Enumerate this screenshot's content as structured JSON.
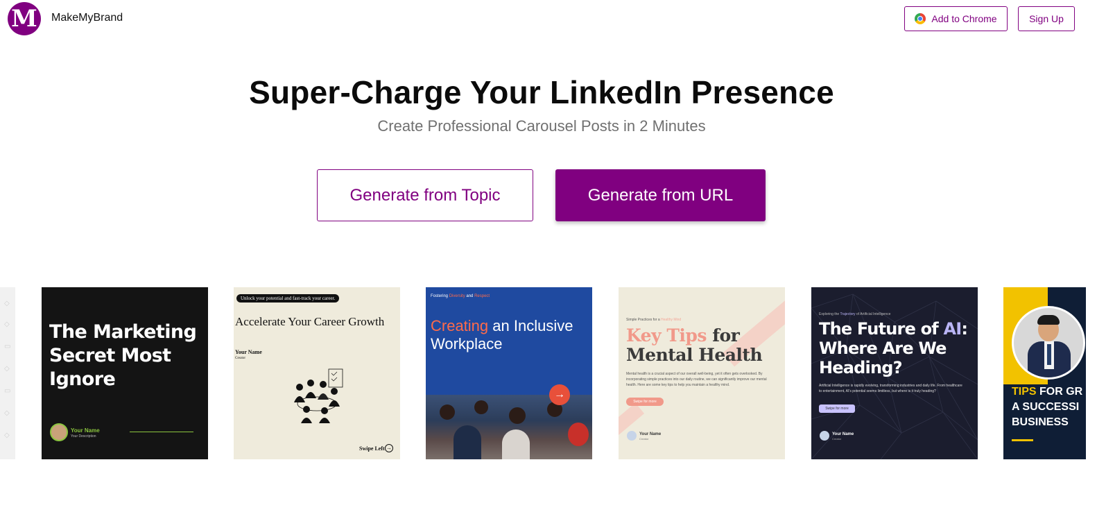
{
  "header": {
    "logo_letter": "M",
    "brand_name": "MakeMyBrand",
    "add_to_chrome_label": "Add to Chrome",
    "sign_up_label": "Sign Up"
  },
  "hero": {
    "title": "Super-Charge Your LinkedIn Presence",
    "subtitle": "Create Professional Carousel Posts in 2 Minutes",
    "generate_topic_label": "Generate from Topic",
    "generate_url_label": "Generate from URL"
  },
  "colors": {
    "brand": "#800080",
    "text": "#0b0b0b",
    "subtitle": "#707070"
  },
  "carousel": {
    "cards": [
      {
        "title": "The Marketing Secret Most Ignore",
        "name": "Your Name",
        "description": "Your Description"
      },
      {
        "tagline": "Unlock your potential and fast-track your career.",
        "title": "Accelerate Your Career Growth",
        "name": "Your Name",
        "role": "Creator",
        "swipe": "Swipe Left"
      },
      {
        "top_pre": "Fostering ",
        "top_a": "Diversity",
        "top_mid": " and ",
        "top_b": "Respect",
        "title_accent": "Creating",
        "title_rest": " an Inclusive Workplace"
      },
      {
        "top_pre": "Simple Practices for a ",
        "top_accent": "Healthy Mind",
        "title_accent": "Key Tips",
        "title_rest": " for Mental Health",
        "body": "Mental health is a crucial aspect of our overall well-being, yet it often gets overlooked. By incorporating simple practices into our daily routine, we can significantly improve our mental health. Here are some key tips to help you maintain a healthy mind.",
        "button": "Swipe for more",
        "name": "Your Name",
        "role": "Creator"
      },
      {
        "top_pre": "Exploring the ",
        "top_accent": "Trajectory",
        "top_post": " of Artificial Intelligence",
        "title_pre": "The Future of ",
        "title_accent": "AI",
        "title_post": ": Where Are We Heading?",
        "body": "Artificial Intelligence is rapidly evolving, transforming industries and daily life. From healthcare to entertainment, AI's potential seems limitless, but where is it truly heading?",
        "button": "Swipe for more",
        "name": "Your Name",
        "role": "Creator"
      },
      {
        "title_accent": "TIPS",
        "title_line1_rest": " FOR GR",
        "title_line2": "A SUCCESSI",
        "title_line3": "BUSINESS"
      }
    ]
  }
}
